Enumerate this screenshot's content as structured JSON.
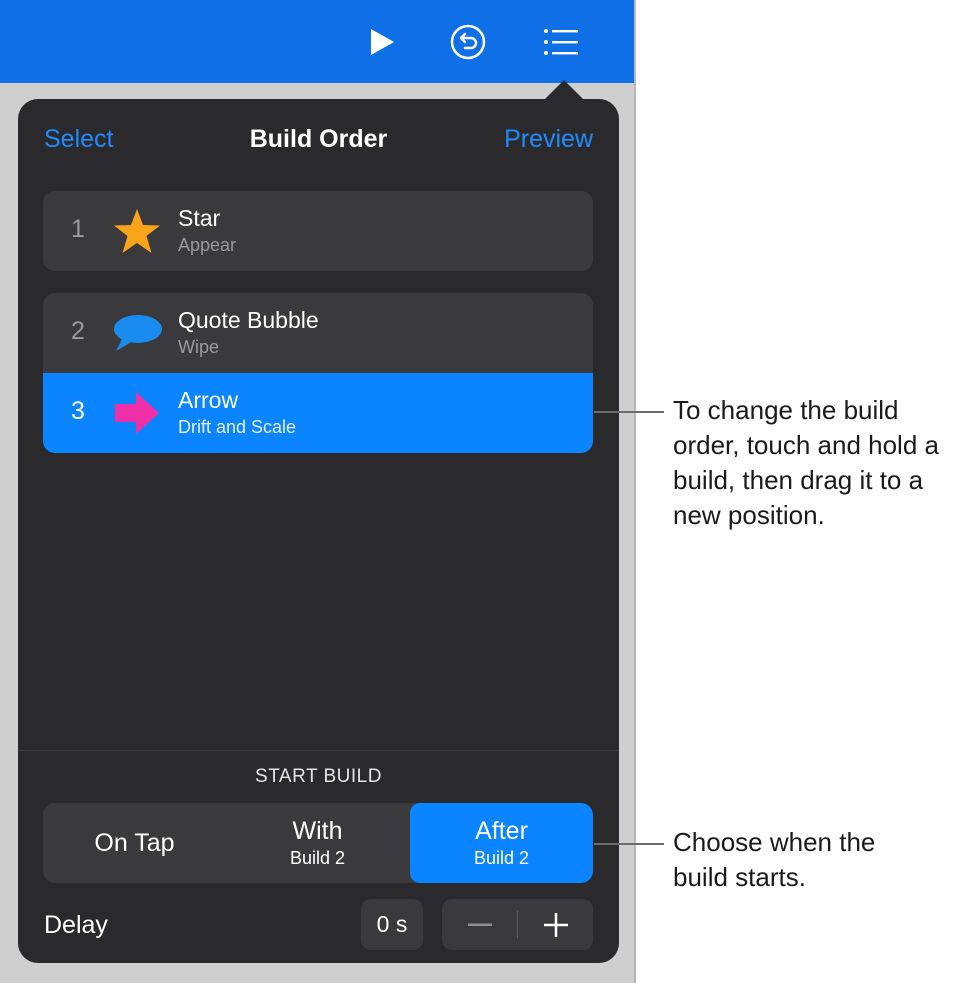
{
  "toolbar": {
    "icons": [
      "play-icon",
      "undo-icon",
      "list-icon"
    ]
  },
  "header": {
    "select_label": "Select",
    "title": "Build Order",
    "preview_label": "Preview"
  },
  "builds": [
    {
      "number": "1",
      "name": "Star",
      "effect": "Appear",
      "icon": "star-icon",
      "icon_color": "#f8a51c"
    },
    {
      "number": "2",
      "name": "Quote Bubble",
      "effect": "Wipe",
      "icon": "speech-bubble-icon",
      "icon_color": "#1a8cf0"
    },
    {
      "number": "3",
      "name": "Arrow",
      "effect": "Drift and Scale",
      "icon": "arrow-right-icon",
      "icon_color": "#ee2fa8",
      "selected": true
    }
  ],
  "start_build": {
    "title": "START BUILD",
    "options": [
      {
        "label": "On Tap",
        "sub": ""
      },
      {
        "label": "With",
        "sub": "Build 2"
      },
      {
        "label": "After",
        "sub": "Build 2",
        "selected": true
      }
    ]
  },
  "delay": {
    "label": "Delay",
    "value": "0 s",
    "minus": "−",
    "plus": "+"
  },
  "callouts": {
    "reorder": "To change the build order, touch and hold a build, then drag it to a new position.",
    "start": "Choose when the build starts."
  },
  "colors": {
    "toolbar": "#0f6fe6",
    "accent": "#0a84ff",
    "link": "#1e8cff",
    "panel": "#2a2a2c",
    "row": "#3a3a3c"
  }
}
